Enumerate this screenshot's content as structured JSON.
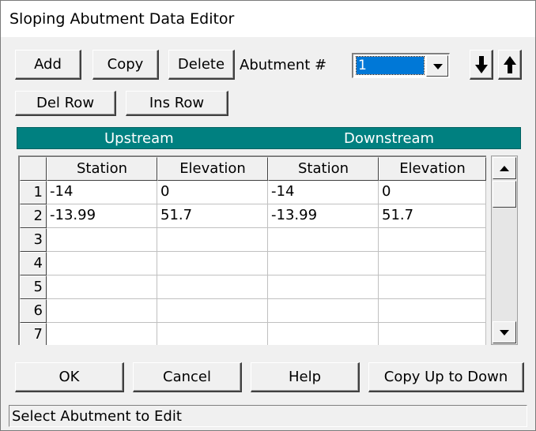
{
  "window": {
    "title": "Sloping Abutment Data Editor"
  },
  "toolbar": {
    "add_label": "Add",
    "copy_label": "Copy",
    "delete_label": "Delete",
    "abutment_label": "Abutment #",
    "abutment_value": "1",
    "down_icon": "arrow-down-icon",
    "up_icon": "arrow-up-icon",
    "del_row_label": "Del Row",
    "ins_row_label": "Ins Row"
  },
  "section_headers": {
    "upstream": "Upstream",
    "downstream": "Downstream"
  },
  "table": {
    "columns": [
      "Station",
      "Elevation",
      "Station",
      "Elevation"
    ],
    "row_numbers": [
      "1",
      "2",
      "3",
      "4",
      "5",
      "6",
      "7"
    ],
    "rows": [
      [
        "-14",
        "0",
        "-14",
        "0"
      ],
      [
        "-13.99",
        "51.7",
        "-13.99",
        "51.7"
      ],
      [
        "",
        "",
        "",
        ""
      ],
      [
        "",
        "",
        "",
        ""
      ],
      [
        "",
        "",
        "",
        ""
      ],
      [
        "",
        "",
        "",
        ""
      ],
      [
        "",
        "",
        "",
        ""
      ]
    ]
  },
  "footer": {
    "ok_label": "OK",
    "cancel_label": "Cancel",
    "help_label": "Help",
    "copy_up_down_label": "Copy Up to Down"
  },
  "status": {
    "text": "Select Abutment to Edit"
  },
  "colors": {
    "header_band": "#008080",
    "selection": "#0078d7"
  }
}
